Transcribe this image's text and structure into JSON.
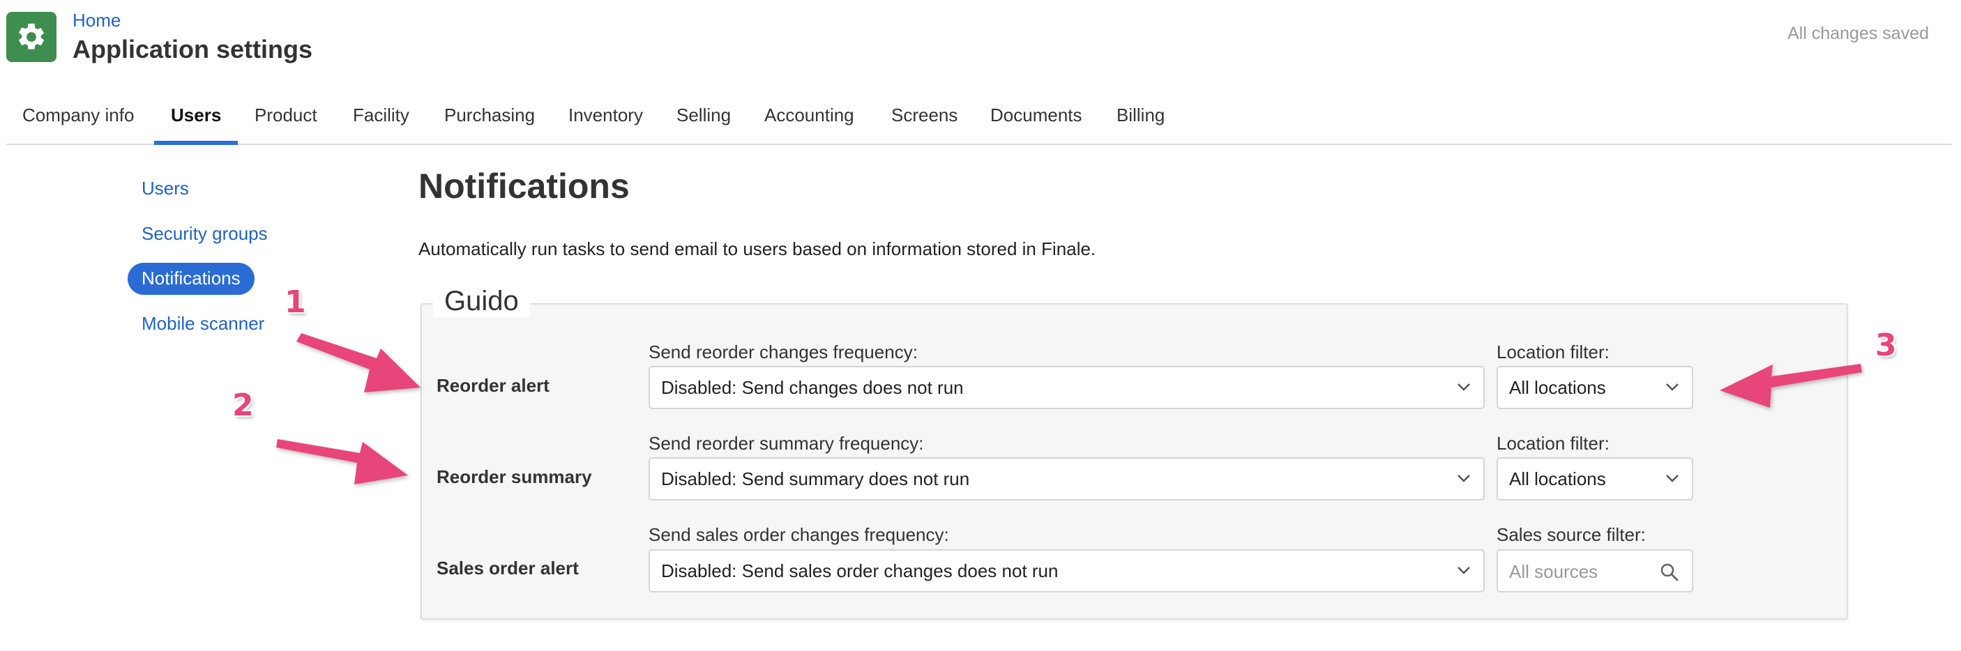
{
  "header": {
    "breadcrumb": "Home",
    "title": "Application settings",
    "save_status": "All changes saved",
    "app_icon": "gear-icon"
  },
  "tabs": [
    {
      "label": "Company info",
      "active": false
    },
    {
      "label": "Users",
      "active": true
    },
    {
      "label": "Product",
      "active": false
    },
    {
      "label": "Facility",
      "active": false
    },
    {
      "label": "Purchasing",
      "active": false
    },
    {
      "label": "Inventory",
      "active": false
    },
    {
      "label": "Selling",
      "active": false
    },
    {
      "label": "Accounting",
      "active": false
    },
    {
      "label": "Screens",
      "active": false
    },
    {
      "label": "Documents",
      "active": false
    },
    {
      "label": "Billing",
      "active": false
    }
  ],
  "sidebar": {
    "items": [
      {
        "label": "Users",
        "active": false
      },
      {
        "label": "Security groups",
        "active": false
      },
      {
        "label": "Notifications",
        "active": true
      },
      {
        "label": "Mobile scanner",
        "active": false
      }
    ]
  },
  "main": {
    "title": "Notifications",
    "description": "Automatically run tasks to send email to users based on information stored in Finale.",
    "group": {
      "legend": "Guido",
      "rows": [
        {
          "label": "Reorder alert",
          "frequency_label": "Send reorder changes frequency:",
          "frequency_value": "Disabled: Send changes does not run",
          "filter_label": "Location filter:",
          "filter_value": "All locations"
        },
        {
          "label": "Reorder summary",
          "frequency_label": "Send reorder summary frequency:",
          "frequency_value": "Disabled: Send summary does not run",
          "filter_label": "Location filter:",
          "filter_value": "All locations"
        },
        {
          "label": "Sales order alert",
          "frequency_label": "Send sales order changes frequency:",
          "frequency_value": "Disabled: Send sales order changes does not run",
          "filter_label": "Sales source filter:",
          "filter_placeholder": "All sources"
        }
      ]
    }
  },
  "annotations": {
    "numbers": [
      "1",
      "2",
      "3"
    ],
    "color": "#e8457a"
  },
  "colors": {
    "brand_green": "#3e8e4f",
    "link_blue": "#1f63c6",
    "active_blue": "#2a6cd4"
  }
}
